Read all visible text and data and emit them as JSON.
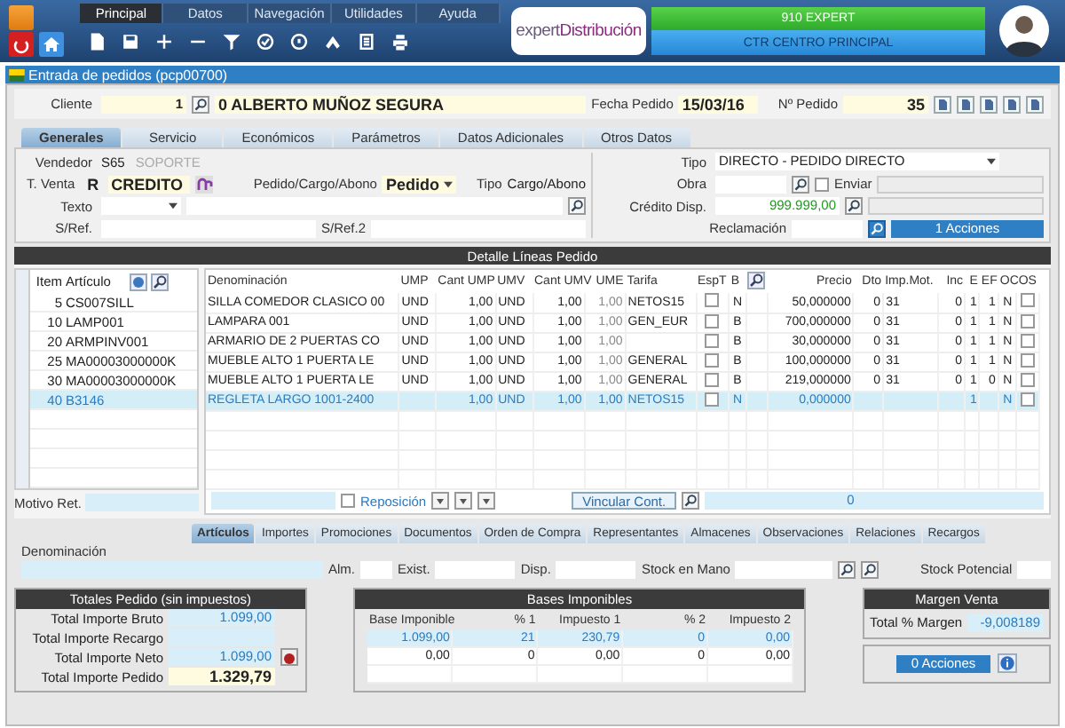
{
  "menu_tabs": [
    {
      "label": "Principal",
      "selected": true
    },
    {
      "label": "Datos",
      "selected": false
    },
    {
      "label": "Navegación",
      "selected": false
    },
    {
      "label": "Utilidades",
      "selected": false
    },
    {
      "label": "Ayuda",
      "selected": false
    }
  ],
  "logo": {
    "prefix": "expert",
    "suffix": "Distribución"
  },
  "company": "910 EXPERT",
  "center": "CTR CENTRO PRINCIPAL",
  "window_title": "Entrada de pedidos (pcp00700)",
  "header": {
    "cliente_label": "Cliente",
    "cliente_code": "1",
    "cliente_name": "0 ALBERTO MUÑOZ SEGURA",
    "fecha_label": "Fecha Pedido",
    "fecha": "15/03/16",
    "pedido_label": "Nº Pedido",
    "pedido": "35"
  },
  "form_tabs": [
    {
      "label": "Generales",
      "selected": true
    },
    {
      "label": "Servicio",
      "selected": false
    },
    {
      "label": "Económicos",
      "selected": false
    },
    {
      "label": "Parámetros",
      "selected": false
    },
    {
      "label": "Datos Adicionales",
      "selected": false
    },
    {
      "label": "Otros Datos",
      "selected": false
    }
  ],
  "general": {
    "vendedor_label": "Vendedor",
    "vendedor_code": "S65",
    "vendedor_name": "SOPORTE",
    "tventa_label": "T. Venta",
    "tventa_code": "R",
    "tventa_name": "CREDITO",
    "pca_label": "Pedido/Cargo/Abono",
    "pca_value": "Pedido",
    "tipo_label": "Tipo",
    "tipo_value": "Cargo/Abono",
    "texto_label": "Texto",
    "sref_label": "S/Ref.",
    "sref2_label": "S/Ref.2",
    "tipo2_label": "Tipo",
    "tipo2_value": "DIRECTO - PEDIDO DIRECTO",
    "obra_label": "Obra",
    "enviar_label": "Enviar",
    "enviar_checked": false,
    "credito_label": "Crédito Disp.",
    "credito_value": "999.999,00",
    "reclamacion_label": "Reclamación",
    "acciones": "1 Acciones"
  },
  "detail": {
    "title": "Detalle Líneas Pedido",
    "left_columns": [
      "Item",
      "Artículo"
    ],
    "columns": [
      "Denominación",
      "UMP",
      "Cant UMP",
      "UMV",
      "Cant UMV",
      "UME",
      "Tarifa",
      "EspT",
      "B",
      "Precio",
      "Dto",
      "Imp.Mot.",
      "Inc",
      "E",
      "EF",
      "OC",
      "OS"
    ],
    "rows": [
      {
        "item": "5",
        "articulo": "CS007SILL",
        "denominacion": "SILLA COMEDOR CLASICO 00",
        "ump": "UND",
        "cant_ump": "1,00",
        "umv": "UND",
        "cant_umv": "1,00",
        "ume": "1,00",
        "tarifa": "NETOS15",
        "esp_t": false,
        "b": "N",
        "precio": "50,000000",
        "dto": "0",
        "imp_mot": "31",
        "inc": "0",
        "e": "1",
        "ef": "1",
        "oc": "N",
        "os": false,
        "selected": false
      },
      {
        "item": "10",
        "articulo": "LAMP001",
        "denominacion": "LAMPARA 001",
        "ump": "UND",
        "cant_ump": "1,00",
        "umv": "UND",
        "cant_umv": "1,00",
        "ume": "1,00",
        "tarifa": "GEN_EUR",
        "esp_t": false,
        "b": "B",
        "precio": "700,000000",
        "dto": "0",
        "imp_mot": "31",
        "inc": "0",
        "e": "1",
        "ef": "1",
        "oc": "N",
        "os": false,
        "selected": false
      },
      {
        "item": "20",
        "articulo": "ARMPINV001",
        "denominacion": "ARMARIO DE 2 PUERTAS CO",
        "ump": "UND",
        "cant_ump": "1,00",
        "umv": "UND",
        "cant_umv": "1,00",
        "ume": "1,00",
        "esp_t": false,
        "b": "B",
        "precio": "30,000000",
        "dto": "0",
        "imp_mot": "31",
        "inc": "0",
        "e": "1",
        "ef": "1",
        "oc": "N",
        "os": false,
        "selected": false
      },
      {
        "item": "25",
        "articulo": "MA00003000000K",
        "denominacion": "MUEBLE ALTO 1 PUERTA LE",
        "ump": "UND",
        "cant_ump": "1,00",
        "umv": "UND",
        "cant_umv": "1,00",
        "ume": "1,00",
        "tarifa": "GENERAL",
        "esp_t": false,
        "b": "B",
        "precio": "100,000000",
        "dto": "0",
        "imp_mot": "31",
        "inc": "0",
        "e": "1",
        "ef": "1",
        "oc": "N",
        "os": false,
        "selected": false
      },
      {
        "item": "30",
        "articulo": "MA00003000000K",
        "denominacion": "MUEBLE ALTO 1 PUERTA LE",
        "ump": "UND",
        "cant_ump": "1,00",
        "umv": "UND",
        "cant_umv": "1,00",
        "ume": "1,00",
        "tarifa": "GENERAL",
        "esp_t": false,
        "b": "B",
        "precio": "219,000000",
        "dto": "0",
        "imp_mot": "31",
        "inc": "0",
        "e": "1",
        "ef": "0",
        "oc": "N",
        "os": false,
        "selected": false
      },
      {
        "item": "40",
        "articulo": "B3146",
        "denominacion": "REGLETA LARGO 1001-2400",
        "cant_ump": "1,00",
        "umv": "UND",
        "cant_umv": "1,00",
        "ume": "1,00",
        "tarifa": "NETOS15",
        "esp_t": false,
        "b": "N",
        "precio": "0,000000",
        "e": "1",
        "oc": "N",
        "os": false,
        "selected": true
      }
    ],
    "motivo_label": "Motivo Ret.",
    "reposicion_label": "Reposición",
    "reposicion_checked": false,
    "vincular": "Vincular Cont.",
    "count": "0"
  },
  "bottom_tabs": [
    {
      "label": "Artículos",
      "selected": true
    },
    {
      "label": "Importes",
      "selected": false
    },
    {
      "label": "Promociones",
      "selected": false
    },
    {
      "label": "Documentos",
      "selected": false
    },
    {
      "label": "Orden de Compra",
      "selected": false
    },
    {
      "label": "Representantes",
      "selected": false
    },
    {
      "label": "Almacenes",
      "selected": false
    },
    {
      "label": "Observaciones",
      "selected": false
    },
    {
      "label": "Relaciones",
      "selected": false
    },
    {
      "label": "Recargos",
      "selected": false
    }
  ],
  "articulo": {
    "denominacion_label": "Denominación",
    "alm_label": "Alm.",
    "exist_label": "Exist.",
    "disp_label": "Disp.",
    "stock_mano_label": "Stock en Mano",
    "stock_potencial_label": "Stock Potencial"
  },
  "totals": {
    "title": "Totales Pedido (sin impuestos)",
    "rows": [
      {
        "label": "Total Importe Bruto",
        "value": "1.099,00",
        "highlighted": false
      },
      {
        "label": "Total Importe Recargo",
        "highlighted": false
      },
      {
        "label": "Total Importe Neto",
        "value": "1.099,00",
        "highlighted": false
      },
      {
        "label": "Total Importe Pedido",
        "value": "1.329,79",
        "highlighted": true
      }
    ]
  },
  "bases": {
    "title": "Bases Imponibles",
    "columns": [
      "Base Imponible",
      "% 1",
      "Impuesto 1",
      "% 2",
      "Impuesto 2"
    ],
    "rows": [
      {
        "cells": [
          "1.099,00",
          "21",
          "230,79",
          "0",
          "0,00"
        ],
        "selected": true
      },
      {
        "cells": [
          "0,00",
          "0",
          "0,00",
          "0",
          "0,00"
        ],
        "selected": false
      }
    ]
  },
  "margen": {
    "title": "Margen Venta",
    "label": "Total % Margen",
    "value": "-9,008189"
  },
  "acciones": "0 Acciones"
}
